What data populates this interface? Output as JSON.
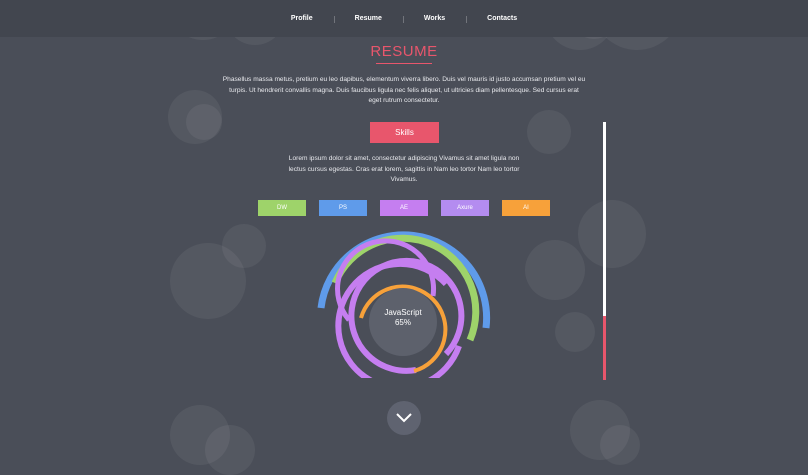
{
  "nav": {
    "items": [
      {
        "label": "Profile"
      },
      {
        "label": "Resume"
      },
      {
        "label": "Works"
      },
      {
        "label": "Contacts"
      }
    ]
  },
  "header": {
    "title": "RESUME"
  },
  "intro": {
    "text": "Phasellus massa metus, pretium eu leo dapibus, elementum viverra libero. Duis vel mauris id justo accumsan pretium vel eu turpis. Ut hendrerit convallis magna. Duis faucibus ligula nec felis aliquet, ut ultricies diam pellentesque. Sed cursus erat eget rutrum consectetur."
  },
  "skills": {
    "button_label": "Skills",
    "text": "Lorem ipsum dolor sit amet, consectetur adipiscing Vivamus sit amet ligula non lectus cursus egestas. Cras erat lorem, sagittis in Nam leo tortor Nam leo tortor Vivamus.",
    "tags": [
      {
        "label": "DW",
        "color": "#9ed36a"
      },
      {
        "label": "PS",
        "color": "#5f9bea"
      },
      {
        "label": "AE",
        "color": "#c57ef0"
      },
      {
        "label": "Axure",
        "color": "#b48cf0"
      },
      {
        "label": "AI",
        "color": "#f7a13a"
      }
    ],
    "selected": {
      "name": "JavaScript",
      "percent": "65%"
    }
  },
  "scrollbar": {
    "progress": 0.25
  },
  "colors": {
    "accent": "#e8566c",
    "background": "#4a4e58",
    "ring_blue": "#5f9bea",
    "ring_green": "#9ed36a",
    "ring_purple": "#c57ef0",
    "ring_orange": "#f7a13a"
  },
  "icons": {
    "scroll_down": "chevron-down-icon"
  }
}
